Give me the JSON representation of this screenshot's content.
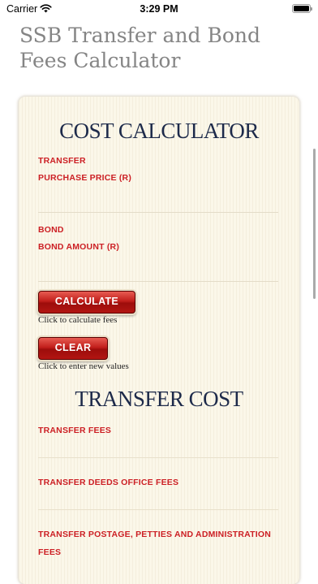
{
  "status_bar": {
    "carrier": "Carrier",
    "time": "3:29 PM"
  },
  "app": {
    "title": "SSB Transfer and Bond Fees Calculator"
  },
  "calculator": {
    "heading": "COST CALCULATOR",
    "transfer_section": "TRANSFER",
    "purchase_price_label": "PURCHASE PRICE (R)",
    "purchase_price_value": "",
    "bond_section": "BOND",
    "bond_amount_label": "BOND AMOUNT (R)",
    "bond_amount_value": "",
    "calculate_label": "CALCULATE",
    "calculate_hint": "Click to calculate fees",
    "clear_label": "CLEAR",
    "clear_hint": "Click to enter new values"
  },
  "transfer_cost": {
    "heading": "TRANSFER COST",
    "transfer_fees_label": "TRANSFER FEES",
    "deeds_office_fees_label": "TRANSFER DEEDS OFFICE FEES",
    "postage_label_line1": "TRANSFER POSTAGE, PETTIES AND ADMINISTRATION",
    "postage_label_line2": "FEES"
  },
  "icons": {
    "wifi": "wifi-icon",
    "battery": "battery-icon"
  },
  "colors": {
    "accent_red": "#cc1f24",
    "heading_navy": "#1d2a4a",
    "card_bg": "#fbf7e9"
  }
}
